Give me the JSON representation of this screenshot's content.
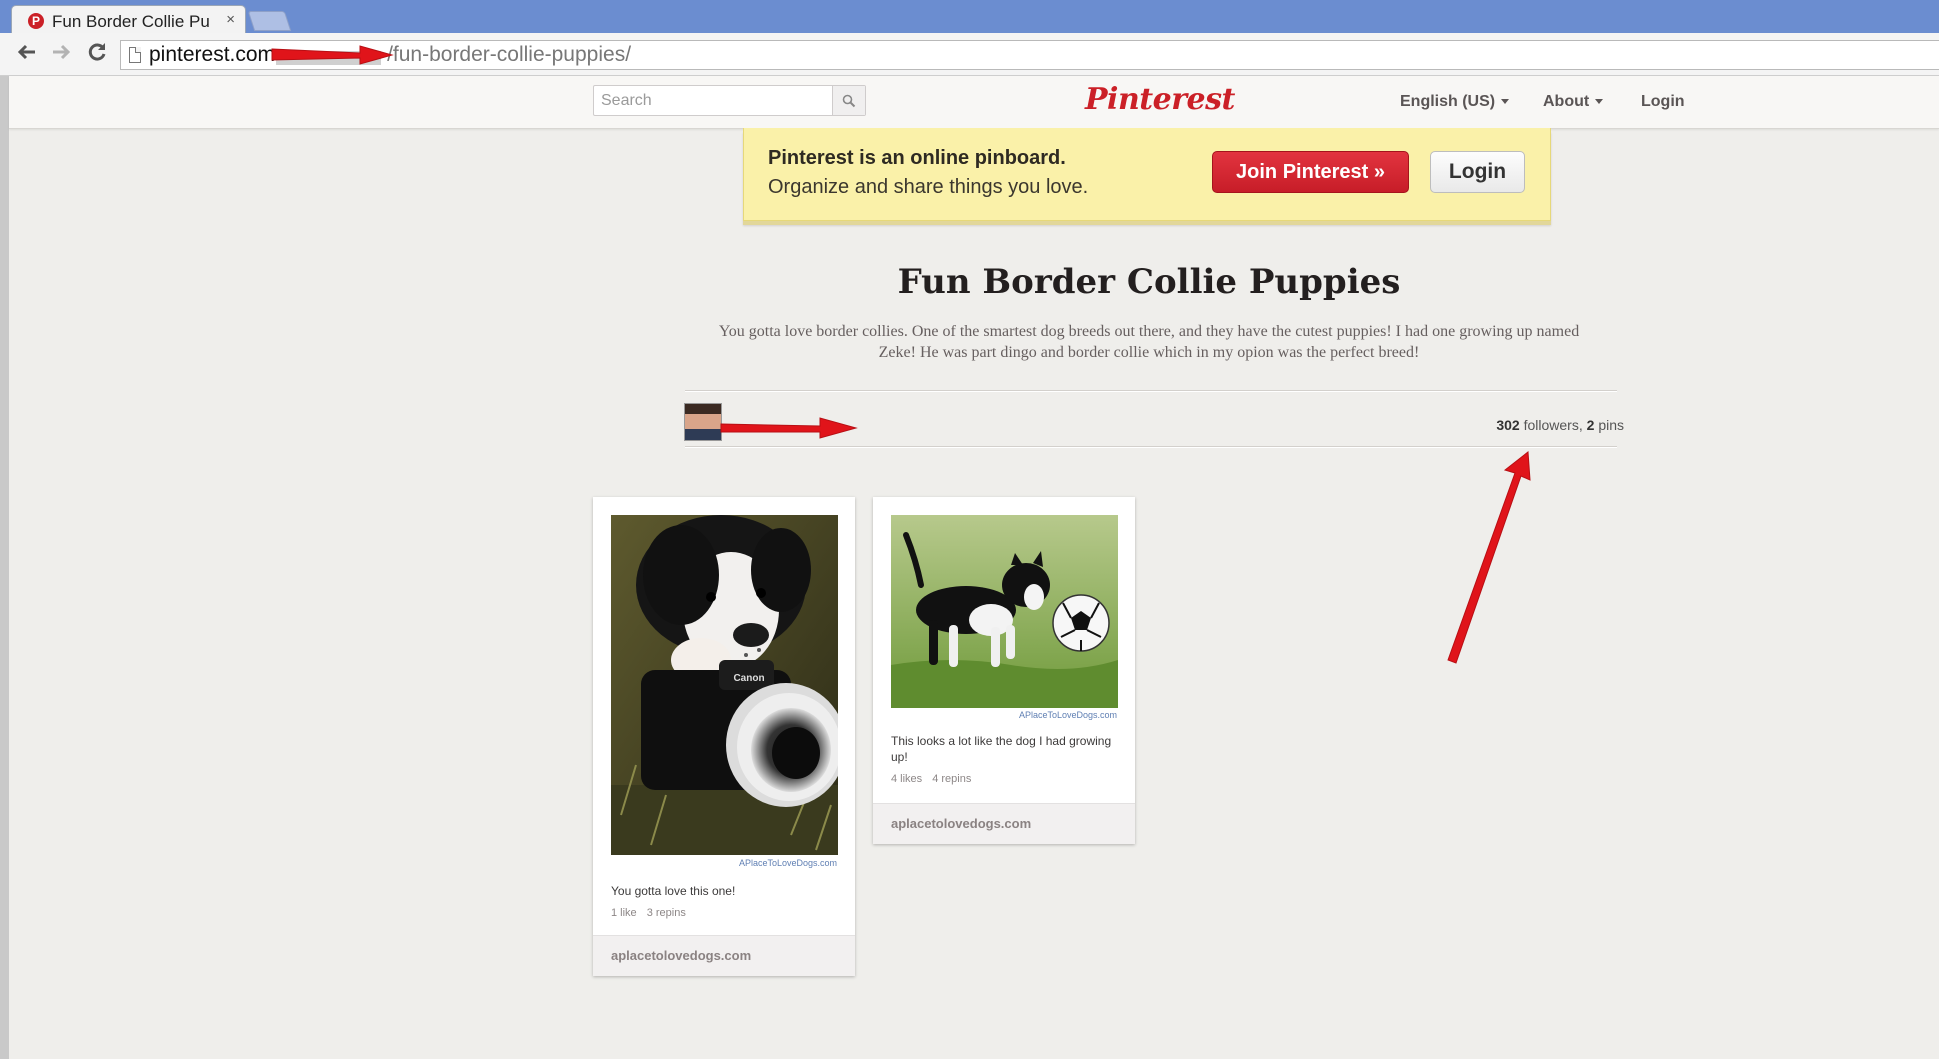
{
  "browser": {
    "tab_title": "Fun Border Collie Pu",
    "tab_close": "×",
    "url_host": "pinterest.com",
    "url_path": "/fun-border-collie-puppies/"
  },
  "header": {
    "search_placeholder": "Search",
    "logo": "Pinterest",
    "language": "English (US)",
    "about": "About",
    "login": "Login"
  },
  "banner": {
    "title": "Pinterest is an online pinboard.",
    "subtitle": "Organize and share things you love.",
    "join_label": "Join Pinterest »",
    "login_label": "Login"
  },
  "board": {
    "title": "Fun Border Collie Puppies",
    "description": "You gotta love border collies. One of the smartest dog breeds out there, and they have the cutest puppies! I had one growing up named Zeke! He was part dingo and border collie which in my opion was the perfect breed!",
    "followers": "302",
    "followers_label": "followers,",
    "pins": "2",
    "pins_label": "pins"
  },
  "pins": [
    {
      "caption": "You gotta love this one!",
      "likes": "1 like",
      "repins": "3 repins",
      "source": "aplacetolovedogs.com",
      "watermark": "APlaceToLoveDogs.com",
      "camera_brand": "Canon"
    },
    {
      "caption": "This looks a lot like the dog I had growing up!",
      "likes": "4 likes",
      "repins": "4 repins",
      "source": "aplacetolovedogs.com",
      "watermark": "APlaceToLoveDogs.com"
    }
  ],
  "colors": {
    "brand_red": "#cb2027",
    "banner_yellow": "#faf1a9",
    "annotation_red": "#e0141a"
  }
}
